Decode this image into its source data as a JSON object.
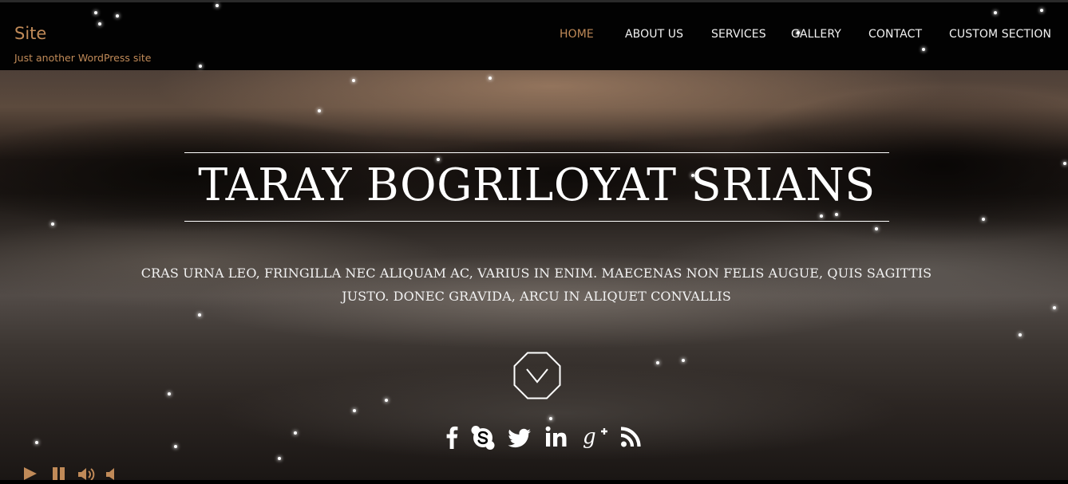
{
  "site": {
    "title": "Site",
    "tagline": "Just another WordPress site",
    "accent_color": "#c08a58"
  },
  "nav": {
    "items": [
      {
        "label": "HOME",
        "active": true
      },
      {
        "label": "ABOUT US",
        "active": false
      },
      {
        "label": "SERVICES",
        "active": false
      },
      {
        "label": "GALLERY",
        "active": false
      },
      {
        "label": "CONTACT",
        "active": false
      },
      {
        "label": "CUSTOM SECTION",
        "active": false
      }
    ]
  },
  "hero": {
    "title": "TARAY BOGRILOYAT SRIANS",
    "description": "CRAS URNA LEO, FRINGILLA NEC ALIQUAM AC, VARIUS IN ENIM. MAECENAS NON FELIS AUGUE, QUIS SAGITTIS JUSTO. DONEC GRAVIDA, ARCU IN ALIQUET CONVALLIS",
    "scroll_icon": "chevron-down-octagon-icon",
    "background": "lake-reflection-video"
  },
  "social": {
    "icons": [
      "facebook-icon",
      "skype-icon",
      "twitter-icon",
      "linkedin-icon",
      "google-plus-icon",
      "rss-icon"
    ]
  },
  "player": {
    "icons": [
      "play-icon",
      "pause-icon",
      "volume-icon",
      "mute-icon"
    ]
  }
}
